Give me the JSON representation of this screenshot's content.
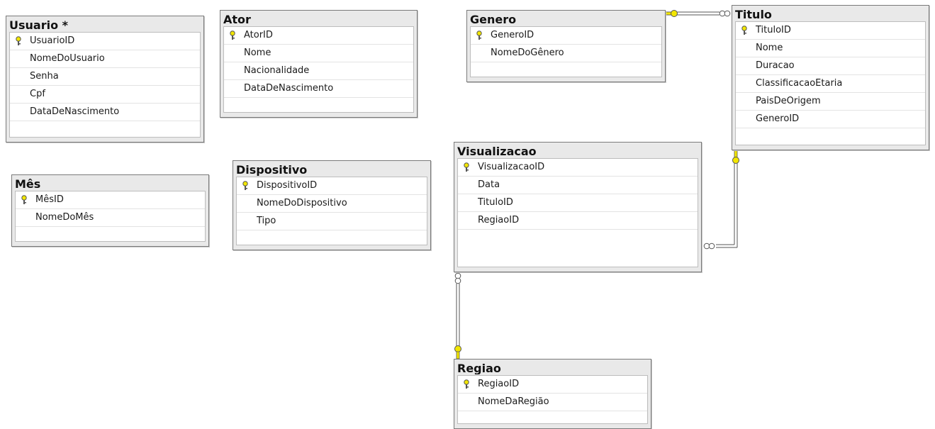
{
  "tables": [
    {
      "id": "usuario",
      "title": "Usuario *",
      "columns": [
        {
          "name": "UsuarioID",
          "pk": true
        },
        {
          "name": "NomeDoUsuario"
        },
        {
          "name": "Senha"
        },
        {
          "name": "Cpf"
        },
        {
          "name": "DataDeNascimento"
        }
      ]
    },
    {
      "id": "ator",
      "title": "Ator",
      "columns": [
        {
          "name": "AtorID",
          "pk": true
        },
        {
          "name": "Nome"
        },
        {
          "name": "Nacionalidade"
        },
        {
          "name": "DataDeNascimento"
        }
      ]
    },
    {
      "id": "genero",
      "title": "Genero",
      "columns": [
        {
          "name": "GeneroID",
          "pk": true
        },
        {
          "name": "NomeDoGênero"
        }
      ]
    },
    {
      "id": "titulo",
      "title": "Titulo",
      "columns": [
        {
          "name": "TituloID",
          "pk": true
        },
        {
          "name": "Nome"
        },
        {
          "name": "Duracao"
        },
        {
          "name": "ClassificacaoEtaria"
        },
        {
          "name": "PaisDeOrigem"
        },
        {
          "name": "GeneroID"
        }
      ]
    },
    {
      "id": "mes",
      "title": "Mês",
      "columns": [
        {
          "name": "MêsID",
          "pk": true
        },
        {
          "name": "NomeDoMês"
        }
      ]
    },
    {
      "id": "dispositivo",
      "title": "Dispositivo",
      "columns": [
        {
          "name": "DispositivoID",
          "pk": true
        },
        {
          "name": "NomeDoDispositivo"
        },
        {
          "name": "Tipo"
        }
      ]
    },
    {
      "id": "visualizacao",
      "title": "Visualizacao",
      "columns": [
        {
          "name": "VisualizacaoID",
          "pk": true
        },
        {
          "name": "Data"
        },
        {
          "name": "TituloID"
        },
        {
          "name": "RegiaoID"
        }
      ]
    },
    {
      "id": "regiao",
      "title": "Regiao",
      "columns": [
        {
          "name": "RegiaoID",
          "pk": true
        },
        {
          "name": "NomeDaRegião"
        }
      ]
    }
  ],
  "relationships": [
    {
      "from": "genero",
      "to": "titulo",
      "one_end": "genero",
      "many_end": "titulo"
    },
    {
      "from": "titulo",
      "to": "visualizacao",
      "one_end": "titulo",
      "many_end": "visualizacao"
    },
    {
      "from": "regiao",
      "to": "visualizacao",
      "one_end": "regiao",
      "many_end": "visualizacao"
    }
  ],
  "colors": {
    "key": "#f2e600",
    "line": "#555555",
    "header": "#e9e9e9"
  }
}
